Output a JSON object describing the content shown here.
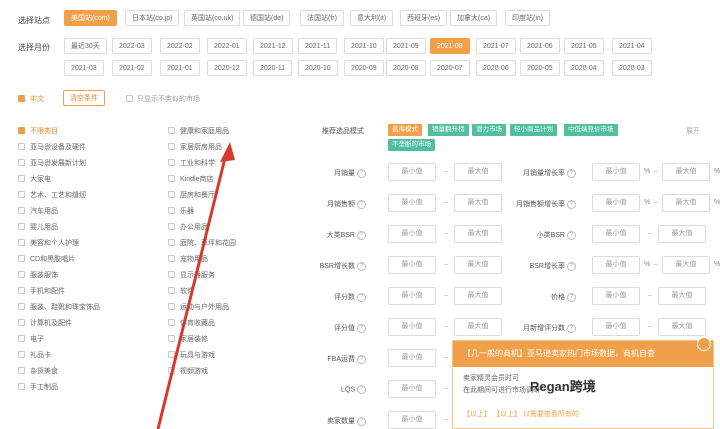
{
  "filters": {
    "site_label": "选择站点",
    "sites": [
      "美国站(com)",
      "日本站(co.jp)",
      "英国站(co.uk)",
      "德国站(de)",
      "法国站(fr)",
      "意大利(it)",
      "西班牙(es)",
      "加拿大(ca)",
      "印度站(in)"
    ],
    "month_label": "选择月份",
    "months_row1": [
      "最近30天",
      "2022-03",
      "2022-02",
      "2022-01",
      "2021-12",
      "2021-11",
      "2021-10",
      "2021-09",
      "2021-08",
      "2021-07",
      "2021-06",
      "2021-05",
      "2021-04"
    ],
    "months_row2": [
      "2021-03",
      "2021-02",
      "2021-01",
      "2020-12",
      "2020-11",
      "2020-10",
      "2020-09",
      "2020-08",
      "2020-07",
      "2020-06",
      "2020-05",
      "2020-04",
      "2020-03"
    ]
  },
  "options": {
    "lang": "中文",
    "clear_button": "清空条件",
    "only_show": "只显示不类似的市场"
  },
  "categories_col1": [
    "不限类目",
    "亚马逊设备及硬件",
    "亚马逊发展新计划",
    "大家电",
    "艺术、工艺和缝纫",
    "汽车用品",
    "婴儿用品",
    "美容和个人护理",
    "CD和黑胶唱片",
    "服装服饰",
    "手机和配件",
    "服装、鞋靴和珠宝饰品",
    "计算机及配件",
    "电子",
    "礼品卡",
    "杂货美食",
    "手工制品"
  ],
  "categories_col2": [
    "健康和家庭用品",
    "家居厨房用品",
    "工业和科学",
    "Kindle商店",
    "厨房和餐厅",
    "乐器",
    "办公用品",
    "庭院、草坪和花园",
    "宠物用品",
    "显示器服务",
    "软件",
    "运动与户外用品",
    "体育收藏品",
    "家居装修",
    "玩具与游戏",
    "视频游戏"
  ],
  "mode": {
    "label": "推荐选品模式",
    "tags": [
      {
        "text": "蓝海模式",
        "color": "orange"
      },
      {
        "text": "销量翻升榜",
        "color": "green"
      },
      {
        "text": "潜力市场",
        "color": "green"
      },
      {
        "text": "轻小商品计划",
        "color": "green"
      },
      {
        "text": "中低端竞价市场",
        "color": "green"
      },
      {
        "text": "不垄断的市场",
        "color": "green"
      }
    ],
    "more": "展开"
  },
  "fields_left": [
    "月销量",
    "月销售额",
    "大类BSR",
    "BSR增长数",
    "评分数",
    "评分值",
    "FBA运费",
    "LQS",
    "卖家数量"
  ],
  "fields_right": [
    "月销量增长率",
    "月销售额增长率",
    "小类BSR",
    "BSR增长率",
    "价格",
    "月新增评分数"
  ],
  "input_placeholders": {
    "min": "最小值",
    "max": "最大值"
  },
  "popup": {
    "title": "【几一般的商机】亚马逊卖家热门市场数据，商机自查",
    "line1": "卖家精灵会员时可",
    "line2": "在此期间可进行市场调研",
    "footer": "【以上】 【以上】 以需要查看所有的"
  },
  "watermark": "Regan跨境",
  "accent_color": "#f0a04b"
}
